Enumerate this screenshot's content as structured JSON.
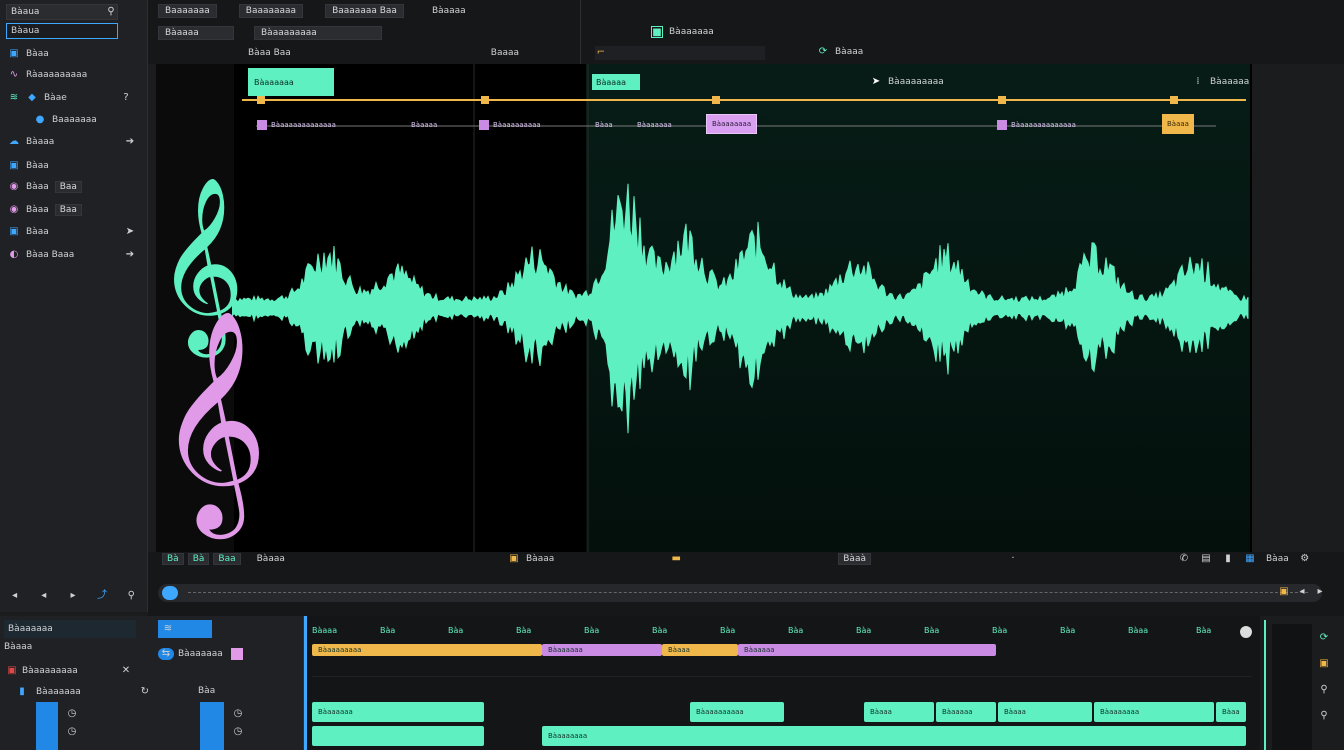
{
  "sidebar": {
    "search_label": "Bàaua",
    "field_label": "Bàaua",
    "sections": [
      {
        "label": "Bàaa",
        "items": [
          {
            "label": "Ràaaaaaaaaa",
            "icon": "waveform-icon"
          },
          {
            "label": "Bàae",
            "icon": "bird-icon"
          },
          {
            "label": "Baaaaaaa",
            "icon": "mic-icon"
          }
        ]
      },
      {
        "label": "Bàaaa",
        "icon": "cloud-icon"
      },
      {
        "label": "Bàaa",
        "items": [
          {
            "label": "Bàaa",
            "extra": "Baa",
            "icon": "eye-icon"
          },
          {
            "label": "Bàaa",
            "extra": "Baa",
            "icon": "eye-icon"
          }
        ]
      },
      {
        "label": "Bàaa",
        "items": [
          {
            "label": "Bàaa Baaa",
            "icon": "cursor-icon"
          }
        ]
      }
    ],
    "bottom": {
      "header": "Bàaaaaaa",
      "sub": "Bàaaa",
      "track": "Bàaaaaaaaa",
      "label": "Bàaaaaaa",
      "fader_label": "Bàa"
    }
  },
  "toolbar": {
    "items": [
      "Baaaaaaa",
      "Baaaaaaaa",
      "Baaaaaaa Baa",
      "Bàaaaa"
    ],
    "row2": [
      "Bàaaaa",
      "Bàaaaaaaaa",
      "Bàaa Baa",
      "Baaaa"
    ],
    "right_title": "Bàaaaaaa",
    "right_label": "Bàaaa",
    "right_status": "Bàaaaaaa"
  },
  "waveform": {
    "top_label": "Bàaaaaaa",
    "region_label": "Bàaaaa",
    "tags": [
      "Bàaaaaaaaaaaaaa",
      "Bàaaaa",
      "Bàaaaaaaaaa",
      "Bàaa",
      "Bàaaaaaa",
      "Bàaaaaaaa",
      "Bàaaaaaaaaaaaaa",
      "Bàaaa"
    ],
    "pointer_label": "Bàaaaaaaaa",
    "right_label": "Bàaaaaa"
  },
  "transport": {
    "left_buttons": [
      "Bà",
      "Bà",
      "Baa"
    ],
    "left_label": "Bàaaa",
    "center_label": "Bàaaa",
    "time": "Bàaà",
    "right_labels": [
      "Bàaa"
    ]
  },
  "timeline": {
    "ruler_labels": [
      "Bàaaa",
      "Bàa",
      "Bàa",
      "Bàa",
      "Bàa",
      "Bàa",
      "Bàa",
      "Bàa",
      "Bàa",
      "Bàa",
      "Bàa",
      "Bàa",
      "Bàaa",
      "Bàa"
    ],
    "track_header": "Bàaaaaaa",
    "clips": [
      "Bàaaaaaaaa",
      "Bàaaaaaa",
      "Bàaaa",
      "Bàaaaaa",
      "Bàaaaaaa",
      "Bàaaaaaaaaa",
      "Bàaaa",
      "Bàaaaaa",
      "Bàaaa",
      "Bàaaaaaaa",
      "Bàaa",
      "Bàaaaaaaa"
    ]
  },
  "colors": {
    "accent_teal": "#5ef0c0",
    "accent_pink": "#e09ae8",
    "accent_gold": "#f0b84a",
    "bg": "#1b1c1e"
  }
}
